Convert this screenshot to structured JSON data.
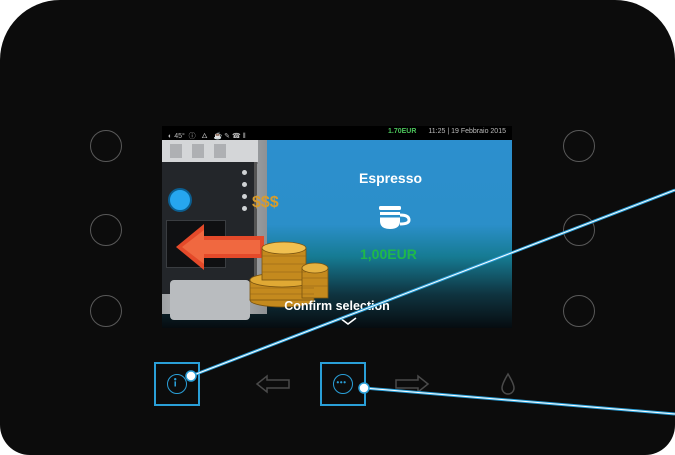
{
  "status_bar": {
    "left_info": "45°",
    "credit": "1.70EUR",
    "datetime": "11:25 | 19 Febbraio 2015"
  },
  "screen": {
    "price_symbol": "$$$",
    "product_name": "Espresso",
    "product_price": "1,00EUR",
    "confirm_label": "Confirm selection"
  },
  "icons": {
    "info": "info-icon",
    "more": "more-options-icon",
    "prev": "arrow-left-icon",
    "next": "arrow-right-icon",
    "water": "water-drop-icon",
    "cup": "espresso-cup-icon"
  },
  "colors": {
    "highlight": "#2a9fd8",
    "price": "#1fb84a",
    "credit": "#4ac25a",
    "sky": "#2c8fce"
  }
}
